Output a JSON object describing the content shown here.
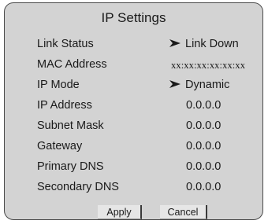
{
  "dialog": {
    "title": "IP Settings"
  },
  "fields": [
    {
      "label": "Link Status",
      "value": "Link Down"
    },
    {
      "label": "MAC Address",
      "value": "xx:xx:xx:xx:xx:xx"
    },
    {
      "label": "IP Mode",
      "value": "Dynamic"
    },
    {
      "label": "IP Address",
      "value": "0.0.0.0"
    },
    {
      "label": "Subnet Mask",
      "value": "0.0.0.0"
    },
    {
      "label": "Gateway",
      "value": "0.0.0.0"
    },
    {
      "label": "Primary DNS",
      "value": "0.0.0.0"
    },
    {
      "label": "Secondary DNS",
      "value": "0.0.0.0"
    }
  ],
  "buttons": {
    "apply_label": "Apply",
    "cancel_label": "Cancel"
  },
  "icons": {
    "selector": "right-arrow-icon"
  },
  "colors": {
    "panel_background": "#d3d3d3",
    "panel_border": "#4a4a4a",
    "button_background": "#e6e6e6",
    "text": "#1a1a1a"
  }
}
